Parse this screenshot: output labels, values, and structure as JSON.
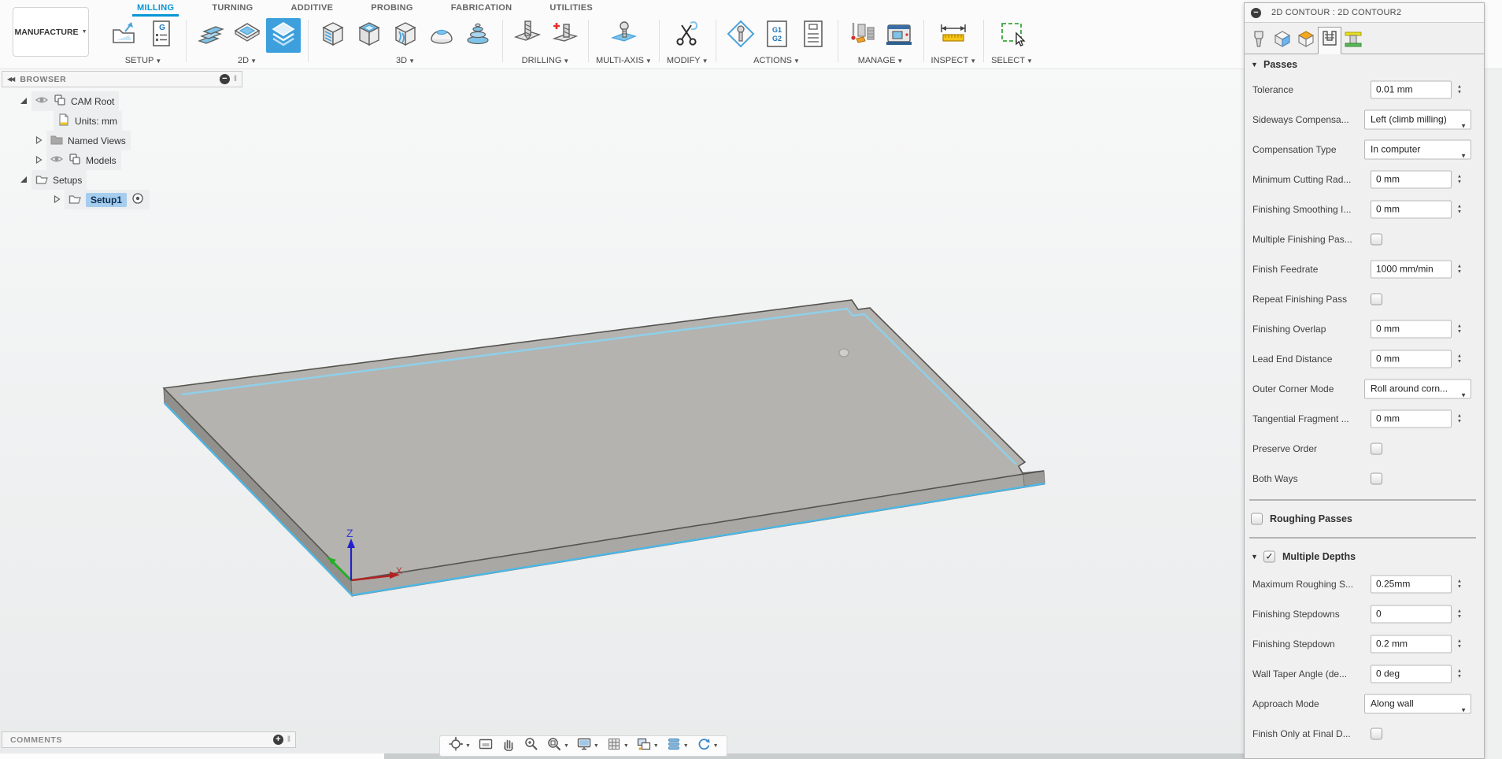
{
  "colors": {
    "accent_blue": "#0696d7",
    "selection_blue": "#a6cdee",
    "contour_highlight": "#47b9ea",
    "active_button_blue": "#3da0dc"
  },
  "workspace_switcher": {
    "label": "MANUFACTURE"
  },
  "workspace_tabs": [
    {
      "label": "MILLING",
      "active": true
    },
    {
      "label": "TURNING",
      "active": false
    },
    {
      "label": "ADDITIVE",
      "active": false
    },
    {
      "label": "PROBING",
      "active": false
    },
    {
      "label": "FABRICATION",
      "active": false
    },
    {
      "label": "UTILITIES",
      "active": false
    }
  ],
  "ribbon": {
    "groups": [
      {
        "label": "SETUP",
        "buttons": [
          {
            "icon": "new-setup-icon"
          },
          {
            "icon": "nc-program-icon"
          }
        ]
      },
      {
        "label": "2D",
        "buttons": [
          {
            "icon": "2d-adaptive-icon"
          },
          {
            "icon": "2d-pocket-icon"
          },
          {
            "icon": "2d-contour-icon",
            "active": true
          }
        ]
      },
      {
        "label": "3D",
        "buttons": [
          {
            "icon": "3d-adaptive-icon"
          },
          {
            "icon": "3d-pocket-icon"
          },
          {
            "icon": "3d-swarf-icon"
          },
          {
            "icon": "3d-scallop-icon"
          },
          {
            "icon": "3d-ramp-icon"
          }
        ]
      },
      {
        "label": "DRILLING",
        "buttons": [
          {
            "icon": "drill-icon"
          },
          {
            "icon": "drill-create-icon"
          }
        ]
      },
      {
        "label": "MULTI-AXIS",
        "buttons": [
          {
            "icon": "multi-axis-icon"
          }
        ]
      },
      {
        "label": "MODIFY",
        "buttons": [
          {
            "icon": "trim-icon"
          }
        ]
      },
      {
        "label": "ACTIONS",
        "buttons": [
          {
            "icon": "post-process-icon"
          },
          {
            "icon": "nc-code-icon"
          },
          {
            "icon": "setup-sheet-icon"
          }
        ]
      },
      {
        "label": "MANAGE",
        "buttons": [
          {
            "icon": "tool-library-icon"
          },
          {
            "icon": "machine-library-icon"
          }
        ]
      },
      {
        "label": "INSPECT",
        "buttons": [
          {
            "icon": "measure-icon"
          }
        ]
      },
      {
        "label": "SELECT",
        "buttons": [
          {
            "icon": "window-select-icon"
          }
        ]
      }
    ]
  },
  "browser": {
    "title": "BROWSER",
    "items": [
      {
        "label": "CAM Root",
        "pad": 22,
        "expand": "expanded",
        "eye": true,
        "icon": "cam-root-icon",
        "selected": false,
        "trailing": null
      },
      {
        "label": "Units: mm",
        "pad": 66,
        "expand": "none",
        "eye": false,
        "icon": "document-icon",
        "selected": false,
        "trailing": null
      },
      {
        "label": "Named Views",
        "pad": 41,
        "expand": "collapsed",
        "eye": false,
        "icon": "folder-icon",
        "selected": false,
        "trailing": null
      },
      {
        "label": "Models",
        "pad": 41,
        "expand": "collapsed",
        "eye": true,
        "icon": "cam-root-icon",
        "selected": false,
        "trailing": null
      },
      {
        "label": "Setups",
        "pad": 22,
        "expand": "expanded",
        "eye": false,
        "icon": "folder-open-icon",
        "selected": false,
        "trailing": null
      },
      {
        "label": "Setup1",
        "pad": 64,
        "expand": "collapsed",
        "eye": false,
        "icon": "folder-open-icon",
        "selected": true,
        "trailing": "target-icon"
      }
    ]
  },
  "canvas": {
    "axis_labels": {
      "z": "Z",
      "x": "X"
    }
  },
  "view_toolbar": {
    "buttons": [
      {
        "icon": "orbit-icon",
        "caret": true
      },
      {
        "icon": "look-at-icon",
        "caret": false
      },
      {
        "icon": "pan-icon",
        "caret": false
      },
      {
        "icon": "zoom-icon",
        "caret": false
      },
      {
        "icon": "zoom-window-icon",
        "caret": true
      },
      {
        "icon": "display-settings-icon",
        "caret": true
      },
      {
        "icon": "grid-icon",
        "caret": true
      },
      {
        "icon": "viewports-icon",
        "caret": true
      },
      {
        "icon": "steps-icon",
        "caret": true
      },
      {
        "icon": "refresh-icon",
        "caret": true
      }
    ]
  },
  "comments": {
    "title": "COMMENTS"
  },
  "dialog": {
    "title": "2D CONTOUR : 2D CONTOUR2",
    "tabs": [
      {
        "icon": "tool-tab-icon",
        "selected": false
      },
      {
        "icon": "geometry-tab-icon",
        "selected": false
      },
      {
        "icon": "heights-tab-icon",
        "selected": false
      },
      {
        "icon": "passes-tab-icon",
        "selected": true
      },
      {
        "icon": "linking-tab-icon",
        "selected": false
      }
    ],
    "rows": [
      {
        "type": "section",
        "label": "Passes"
      },
      {
        "type": "spinner",
        "label": "Tolerance",
        "value": "0.01 mm"
      },
      {
        "type": "dropdown",
        "label": "Sideways Compensa...",
        "value": "Left (climb milling)"
      },
      {
        "type": "dropdown",
        "label": "Compensation Type",
        "value": "In computer"
      },
      {
        "type": "spinner",
        "label": "Minimum Cutting Rad...",
        "value": "0 mm"
      },
      {
        "type": "spinner",
        "label": "Finishing Smoothing I...",
        "value": "0 mm"
      },
      {
        "type": "checkbox",
        "label": "Multiple Finishing Pas...",
        "checked": false
      },
      {
        "type": "spinner",
        "label": "Finish Feedrate",
        "value": "1000 mm/min"
      },
      {
        "type": "checkbox",
        "label": "Repeat Finishing Pass",
        "checked": false
      },
      {
        "type": "spinner",
        "label": "Finishing Overlap",
        "value": "0 mm"
      },
      {
        "type": "spinner",
        "label": "Lead End Distance",
        "value": "0 mm"
      },
      {
        "type": "dropdown",
        "label": "Outer Corner Mode",
        "value": "Roll around corn..."
      },
      {
        "type": "spinner",
        "label": "Tangential Fragment ...",
        "value": "0 mm"
      },
      {
        "type": "checkbox",
        "label": "Preserve Order",
        "checked": false
      },
      {
        "type": "checkbox",
        "label": "Both Ways",
        "checked": false
      },
      {
        "type": "divider"
      },
      {
        "type": "section-checkbox",
        "label": "Roughing Passes",
        "checked": false,
        "triangle": false
      },
      {
        "type": "divider"
      },
      {
        "type": "section-checkbox",
        "label": "Multiple Depths",
        "checked": true,
        "triangle": true
      },
      {
        "type": "spinner",
        "label": "Maximum Roughing S...",
        "value": "0.25mm"
      },
      {
        "type": "spinner",
        "label": "Finishing Stepdowns",
        "value": "0"
      },
      {
        "type": "spinner",
        "label": "Finishing Stepdown",
        "value": "0.2 mm"
      },
      {
        "type": "spinner",
        "label": "Wall Taper Angle (de...",
        "value": "0 deg"
      },
      {
        "type": "dropdown",
        "label": "Approach Mode",
        "value": "Along wall"
      },
      {
        "type": "checkbox",
        "label": "Finish Only at Final D...",
        "checked": false
      }
    ]
  }
}
